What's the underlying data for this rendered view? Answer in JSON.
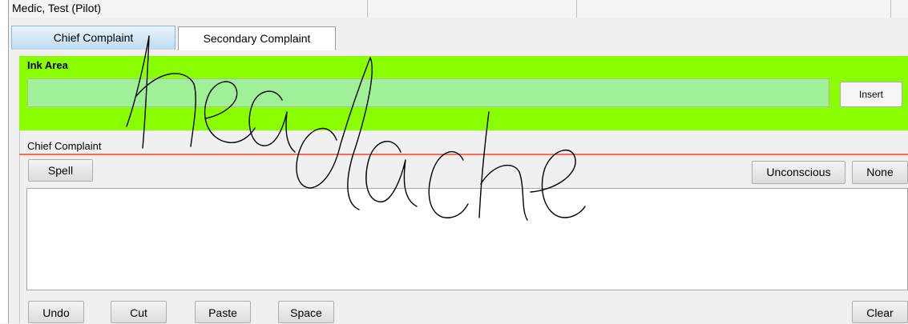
{
  "header": {
    "user": "Medic, Test  (Pilot)"
  },
  "tabs": [
    {
      "label": "Chief Complaint",
      "active": true
    },
    {
      "label": "Secondary Complaint",
      "active": false
    }
  ],
  "ink_area": {
    "legend": "Ink Area",
    "insert_label": "Insert",
    "color": "#8aff00",
    "handwriting": "headache"
  },
  "chief_complaint": {
    "label": "Chief Complaint",
    "spell_label": "Spell",
    "unconscious_label": "Unconscious",
    "none_label": "None",
    "text_value": ""
  },
  "toolbar": {
    "undo_label": "Undo",
    "cut_label": "Cut",
    "paste_label": "Paste",
    "space_label": "Space",
    "clear_label": "Clear"
  }
}
